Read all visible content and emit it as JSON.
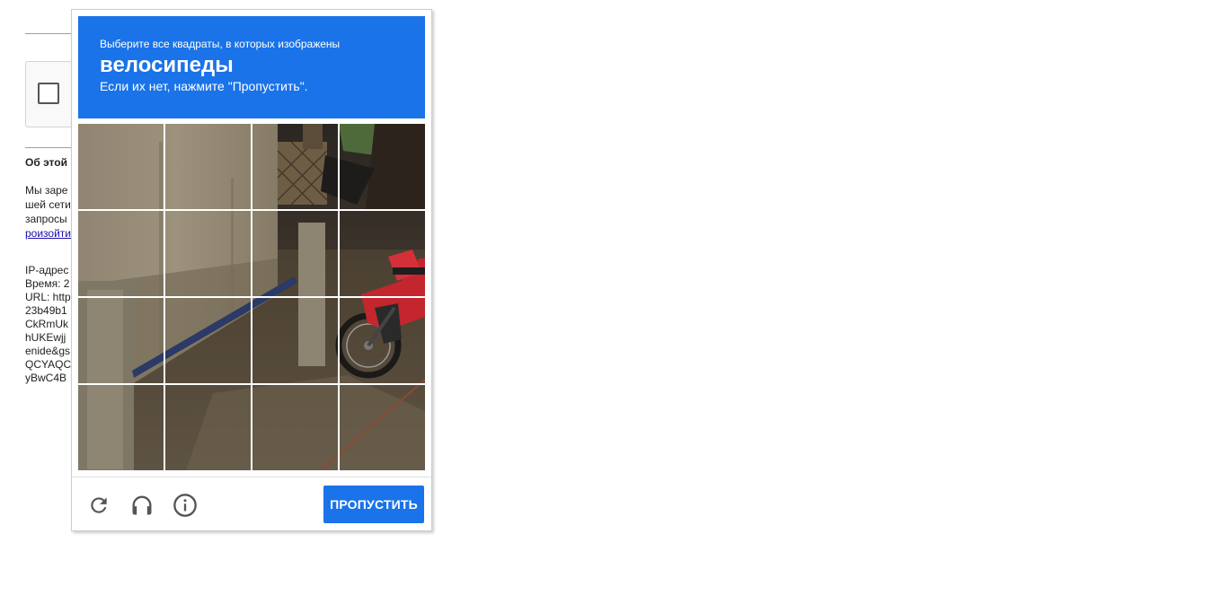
{
  "background_page": {
    "about_title": "Об этой",
    "paragraph_lines": [
      "Мы заре",
      "шей сети",
      "запросы"
    ],
    "paragraph_link": "роизойти",
    "info_lines": [
      "IP-адрес",
      "Время: 2",
      "URL: http",
      "23b49b1",
      "CkRmUk",
      "hUKEwjj",
      "enide&gs",
      "QCYAQC",
      "yBwC4B"
    ]
  },
  "challenge": {
    "instruction_small": "Выберите все квадраты, в которых изображены",
    "instruction_object": "велосипеды",
    "instruction_note": "Если их нет, нажмите \"Пропустить\".",
    "tiles_count": 16,
    "footer": {
      "reload_icon": "reload-icon",
      "audio_icon": "headphones-icon",
      "info_icon": "info-icon",
      "skip_label": "ПРОПУСТИТЬ"
    }
  },
  "colors": {
    "accent": "#1a73e8",
    "icon_gray": "#555555"
  }
}
